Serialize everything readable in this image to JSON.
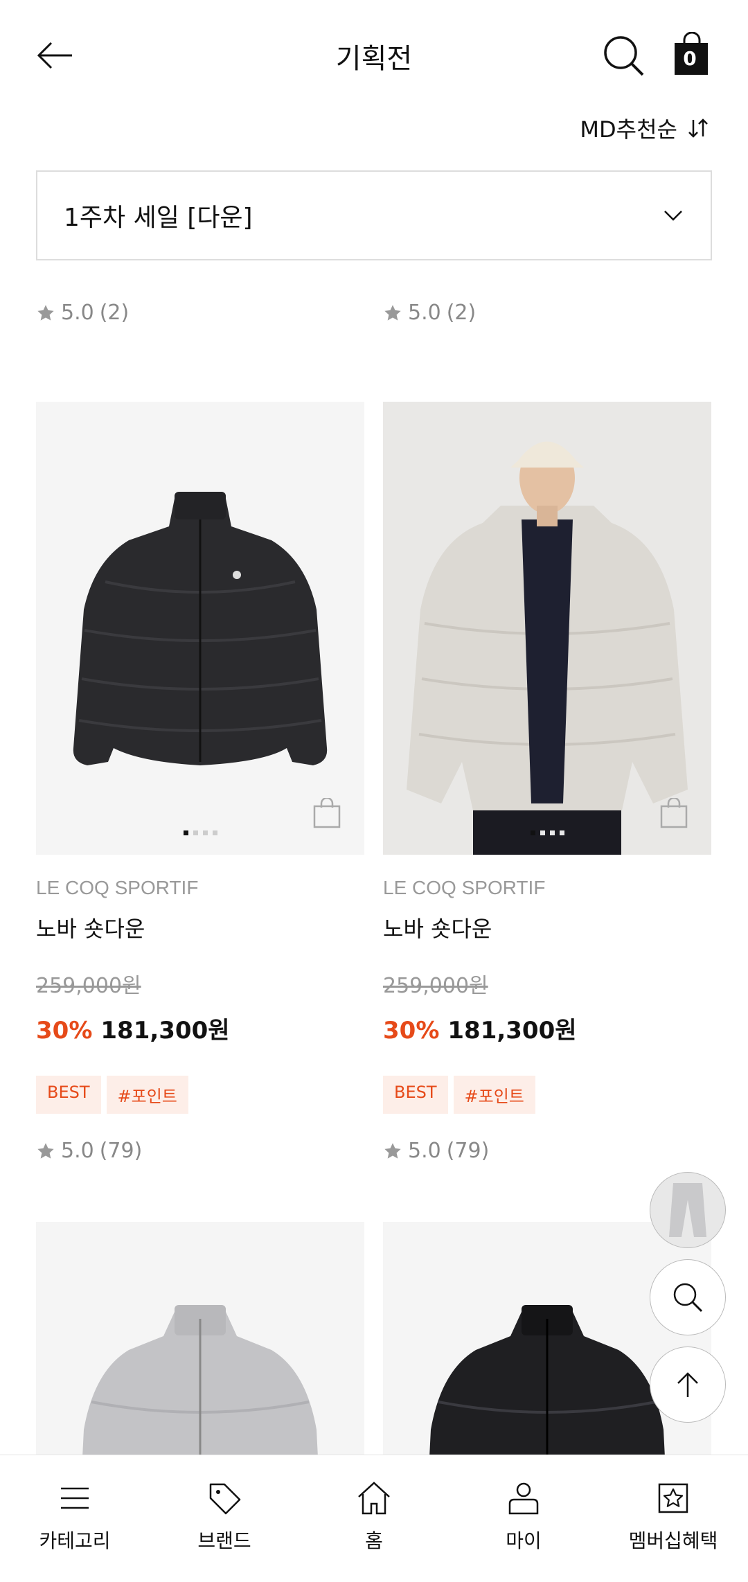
{
  "header": {
    "title": "기획전",
    "cart_count": "0"
  },
  "sort": {
    "label": "MD추천순"
  },
  "filter": {
    "selected": "1주차 세일 [다운]"
  },
  "top_ratings": [
    {
      "value": "5.0",
      "count": "(2)"
    },
    {
      "value": "5.0",
      "count": "(2)"
    }
  ],
  "products": [
    {
      "brand": "LE COQ SPORTIF",
      "name": "노바 숏다운",
      "original_price": "259,000원",
      "discount": "30%",
      "sale_price": "181,300원",
      "tags": [
        "BEST",
        "#포인트"
      ],
      "rating": "5.0",
      "review_count": "(79)",
      "image": "black-puffer-jacket",
      "dots": 4,
      "active_dot": 0
    },
    {
      "brand": "LE COQ SPORTIF",
      "name": "노바 숏다운",
      "original_price": "259,000원",
      "discount": "30%",
      "sale_price": "181,300원",
      "tags": [
        "BEST",
        "#포인트"
      ],
      "rating": "5.0",
      "review_count": "(79)",
      "image": "model-ivory-puffer-jacket",
      "dots": 4,
      "active_dot": 0
    },
    {
      "image": "gray-puffer-jacket"
    },
    {
      "image": "black-glossy-puffer-jacket"
    }
  ],
  "fab": {
    "thumbnail": "gray-jogger-pants",
    "search": "search-icon",
    "top": "arrow-up-icon"
  },
  "bottom_nav": [
    {
      "label": "카테고리",
      "icon": "menu-icon"
    },
    {
      "label": "브랜드",
      "icon": "tag-icon"
    },
    {
      "label": "홈",
      "icon": "home-icon"
    },
    {
      "label": "마이",
      "icon": "person-icon"
    },
    {
      "label": "멤버십혜택",
      "icon": "star-box-icon"
    }
  ],
  "colors": {
    "accent": "#e64a19",
    "tag_bg": "#fdeee8",
    "muted": "#999999"
  }
}
